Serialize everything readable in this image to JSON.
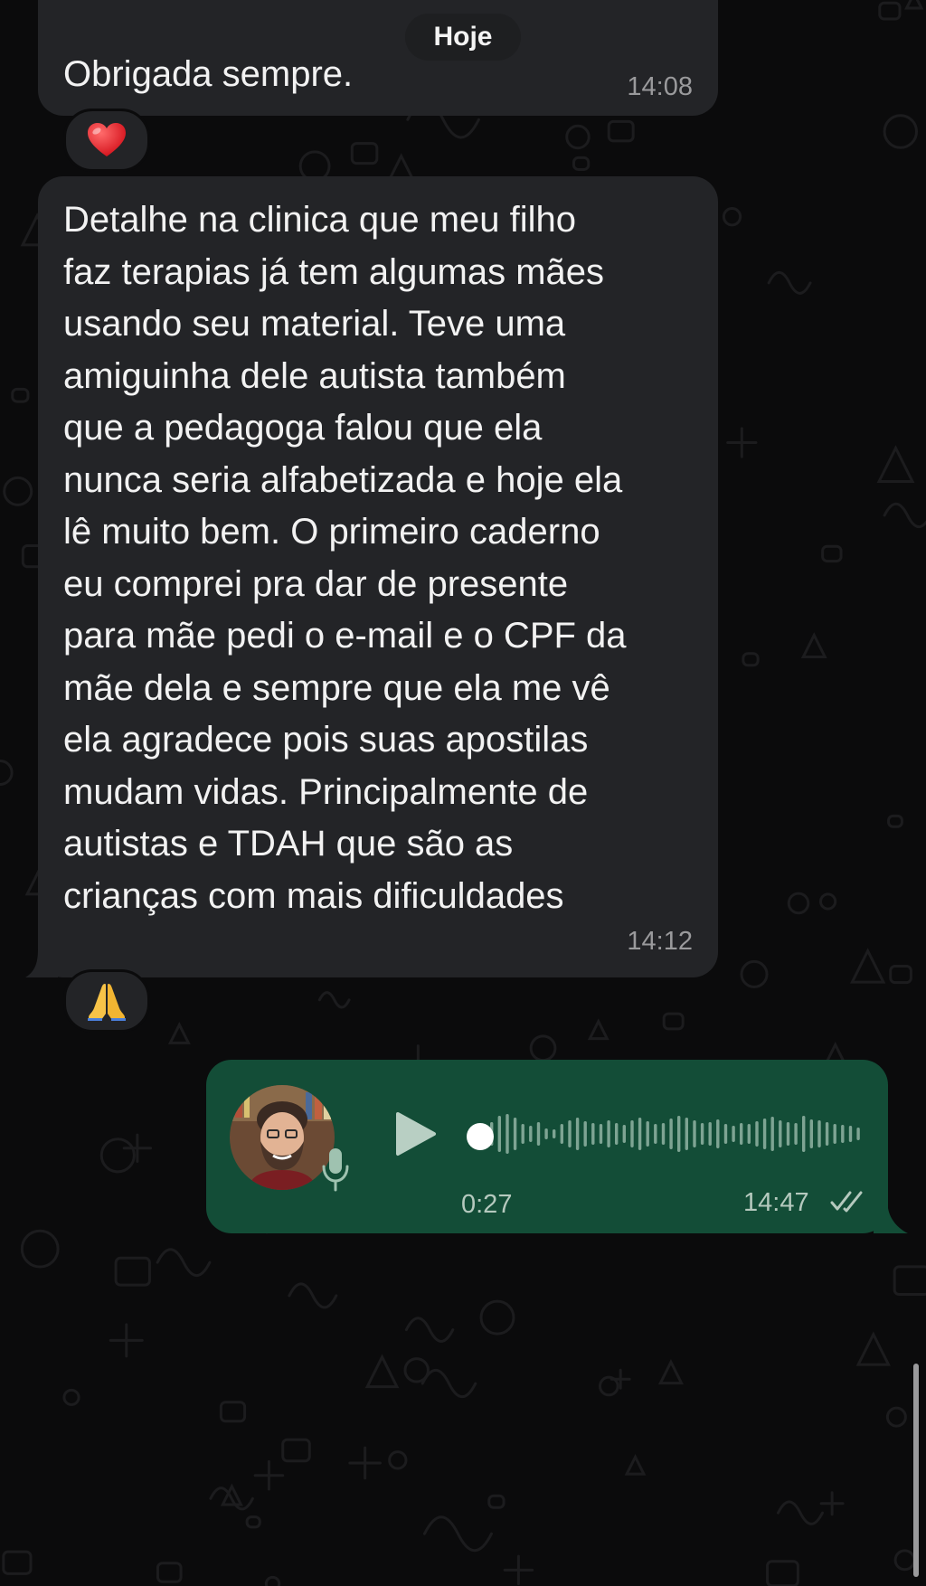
{
  "date_pill": "Hoje",
  "messages": [
    {
      "direction": "incoming",
      "text": "Obrigada sempre.",
      "time": "14:08",
      "reaction_icon": "heart-emoji"
    },
    {
      "direction": "incoming",
      "lines": [
        "Detalhe na clinica que meu filho",
        "faz terapias já tem algumas mães",
        "usando seu material. Teve uma",
        "amiguinha dele autista também",
        "que a pedagoga falou que ela",
        "nunca seria alfabetizada e hoje ela",
        "lê muito bem. O primeiro caderno",
        "eu comprei pra dar de presente",
        "para mãe pedi o e-mail e o CPF da",
        "mãe dela e sempre que ela me vê",
        "ela agradece pois suas apostilas",
        "mudam vidas. Principalmente de",
        "autistas e TDAH que são as",
        "crianças com mais dificuldades"
      ],
      "time": "14:12",
      "reaction_icon": "folded-hands-emoji"
    },
    {
      "direction": "outgoing",
      "type": "voice-note",
      "duration": "0:27",
      "time": "14:47",
      "status_icon": "double-check-icon",
      "played_fraction": 0
    }
  ],
  "colors": {
    "background": "#0b0b0c",
    "incoming_bubble": "#232427",
    "outgoing_bubble": "#134d37",
    "timestamp": "#9a9a9c",
    "outgoing_meta": "#b5c9be"
  }
}
